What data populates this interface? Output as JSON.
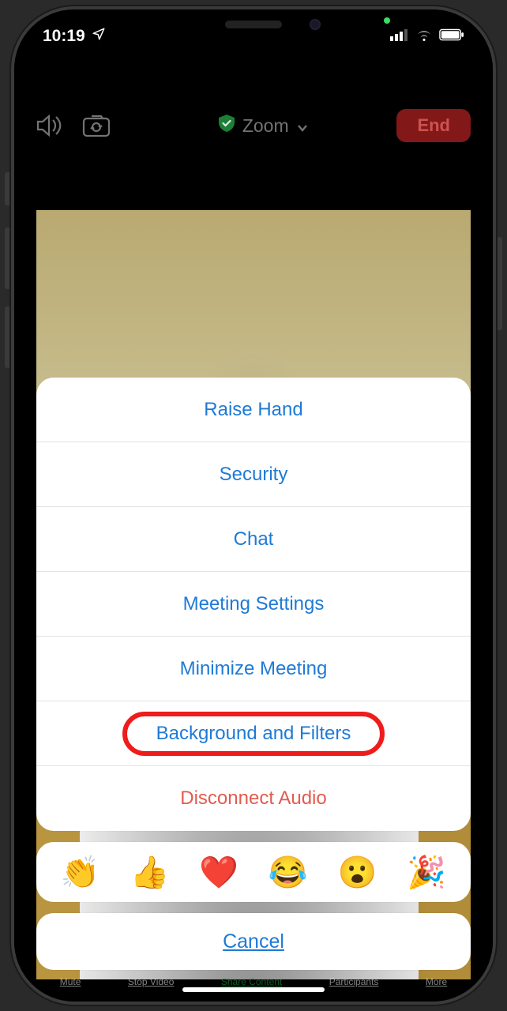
{
  "statusbar": {
    "time": "10:19"
  },
  "topbar": {
    "title": "Zoom",
    "end_label": "End"
  },
  "sheet": {
    "items": [
      {
        "label": "Raise Hand"
      },
      {
        "label": "Security"
      },
      {
        "label": "Chat"
      },
      {
        "label": "Meeting Settings"
      },
      {
        "label": "Minimize Meeting"
      },
      {
        "label": "Background and Filters",
        "highlighted": true
      },
      {
        "label": "Disconnect Audio",
        "danger": true
      }
    ],
    "reactions": [
      "👏",
      "👍",
      "❤️",
      "😂",
      "😮",
      "🎉"
    ],
    "cancel_label": "Cancel"
  },
  "bottom_toolbar": [
    "Mute",
    "Stop Video",
    "Share Content",
    "Participants",
    "More"
  ]
}
